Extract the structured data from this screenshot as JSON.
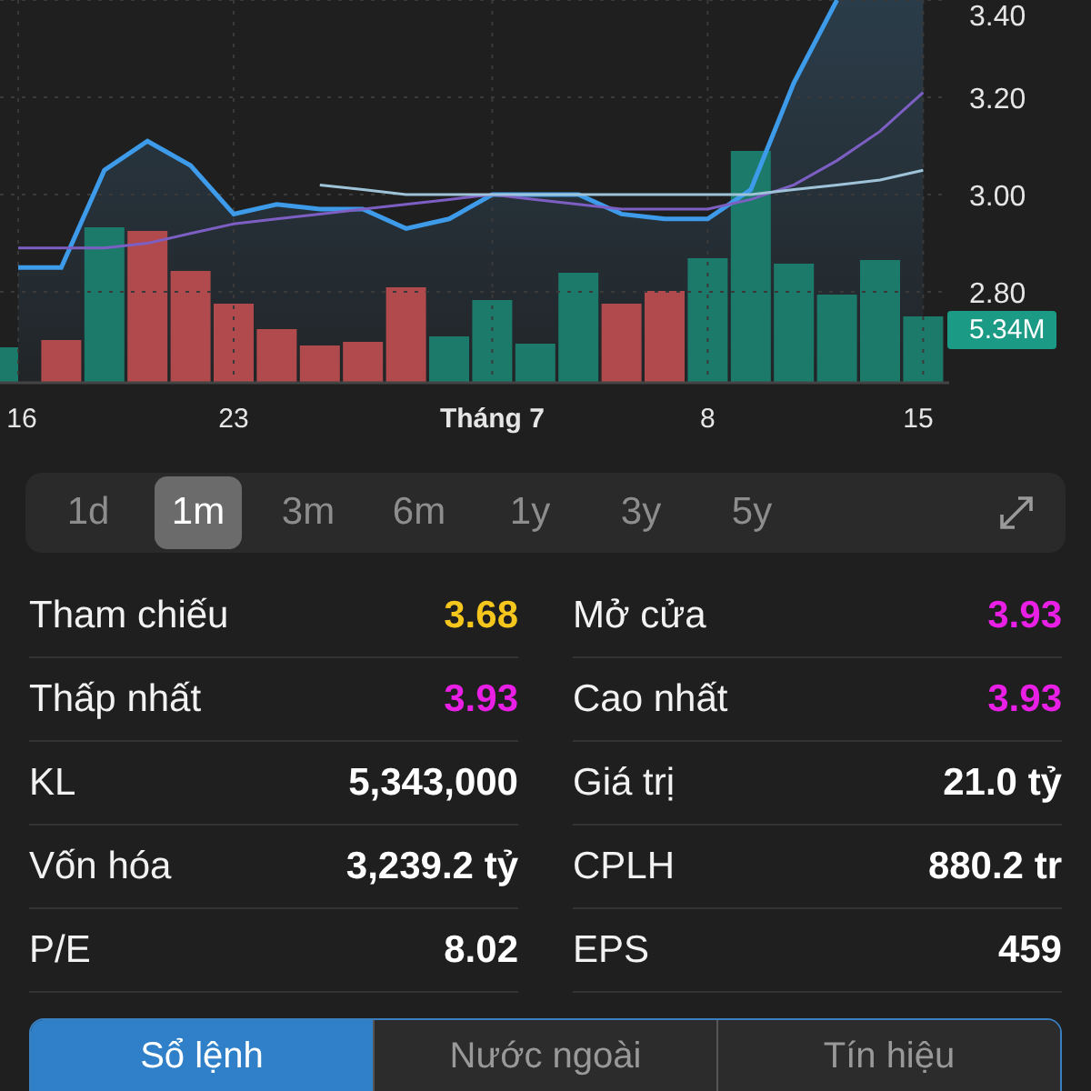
{
  "chart": {
    "volume_badge": "5.34M",
    "chart_data": {
      "type": "line",
      "grid": true,
      "categories": [
        "16",
        null,
        null,
        null,
        null,
        "23",
        null,
        null,
        null,
        null,
        null,
        "Tháng 7",
        null,
        null,
        null,
        null,
        "8",
        null,
        null,
        null,
        null,
        "15"
      ],
      "ylim": [
        2.615,
        3.4
      ],
      "yticks": [
        {
          "value": 2.8,
          "label": "2.80"
        },
        {
          "value": 3.0,
          "label": "3.00"
        },
        {
          "value": 3.2,
          "label": "3.20"
        },
        {
          "value": 3.4,
          "label": "3.40"
        }
      ],
      "series": [
        {
          "color": "#3d9be9",
          "values": [
            2.85,
            2.85,
            3.05,
            3.11,
            3.06,
            2.96,
            2.98,
            2.97,
            2.97,
            2.93,
            2.95,
            3.0,
            3.0,
            3.0,
            2.96,
            2.95,
            2.95,
            3.01,
            3.23,
            3.4,
            null,
            null
          ]
        },
        {
          "color": "#7d5fc4",
          "values": [
            2.89,
            2.89,
            2.89,
            2.9,
            2.92,
            2.94,
            2.95,
            2.96,
            2.97,
            2.98,
            2.99,
            3.0,
            2.99,
            2.98,
            2.97,
            2.97,
            2.97,
            2.99,
            3.02,
            3.07,
            3.13,
            3.21
          ]
        },
        {
          "color": "#9fc3d9",
          "values": [
            null,
            null,
            null,
            null,
            null,
            null,
            null,
            3.02,
            3.01,
            3.0,
            3.0,
            3.0,
            3.0,
            3.0,
            3.0,
            3.0,
            3.0,
            3.0,
            3.01,
            3.02,
            3.03,
            3.05
          ]
        }
      ]
    }
  },
  "periods": [
    {
      "label": "1d",
      "selected": false
    },
    {
      "label": "1m",
      "selected": true
    },
    {
      "label": "3m",
      "selected": false
    },
    {
      "label": "6m",
      "selected": false
    },
    {
      "label": "1y",
      "selected": false
    },
    {
      "label": "3y",
      "selected": false
    },
    {
      "label": "5y",
      "selected": false
    }
  ],
  "stats": [
    {
      "label": "Tham chiếu",
      "value": "3.68",
      "color": "#f5c61c"
    },
    {
      "label": "Mở cửa",
      "value": "3.93",
      "color": "#ea1fe6"
    },
    {
      "label": "Thấp nhất",
      "value": "3.93",
      "color": "#ea1fe6"
    },
    {
      "label": "Cao nhất",
      "value": "3.93",
      "color": "#ea1fe6"
    },
    {
      "label": "KL",
      "value": "5,343,000",
      "color": "#ffffff"
    },
    {
      "label": "Giá trị",
      "value": "21.0 tỷ",
      "color": "#ffffff"
    },
    {
      "label": "Vốn hóa",
      "value": "3,239.2 tỷ",
      "color": "#ffffff"
    },
    {
      "label": "CPLH",
      "value": "880.2 tr",
      "color": "#ffffff"
    },
    {
      "label": "P/E",
      "value": "8.02",
      "color": "#ffffff"
    },
    {
      "label": "EPS",
      "value": "459",
      "color": "#ffffff"
    }
  ],
  "bottom_tabs": [
    {
      "label": "Sổ lệnh",
      "selected": true
    },
    {
      "label": "Nước ngoài",
      "selected": false
    },
    {
      "label": "Tín hiệu",
      "selected": false
    }
  ]
}
